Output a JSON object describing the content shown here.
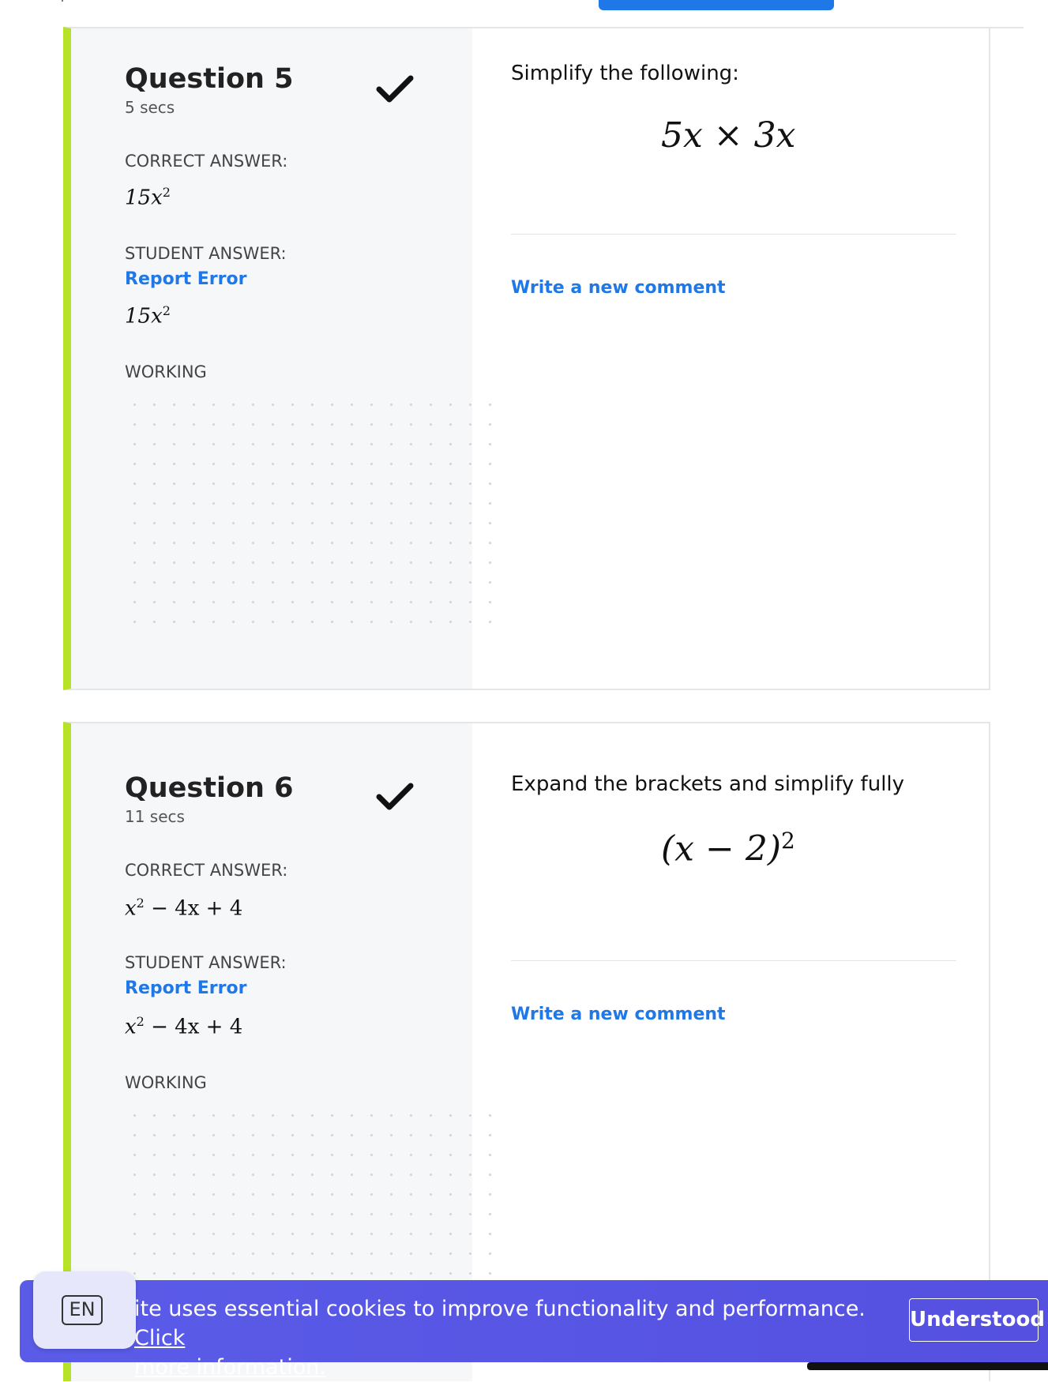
{
  "questions": [
    {
      "title": "Question 5",
      "time": "5 secs",
      "correct_label": "CORRECT ANSWER:",
      "correct_answer": {
        "base": "15x",
        "sup": "2"
      },
      "student_label": "STUDENT ANSWER:",
      "report_error": "Report Error",
      "student_answer": {
        "base": "15x",
        "sup": "2"
      },
      "working_label": "WORKING",
      "prompt": "Simplify the following:",
      "expression": {
        "text": "5x × 3x",
        "sup": ""
      },
      "comment_link": "Write a new comment",
      "status": "correct"
    },
    {
      "title": "Question 6",
      "time": "11 secs",
      "correct_label": "CORRECT ANSWER:",
      "correct_answer": {
        "pre": "x",
        "sup": "2",
        "post": " − 4x + 4"
      },
      "student_label": "STUDENT ANSWER:",
      "report_error": "Report Error",
      "student_answer": {
        "pre": "x",
        "sup": "2",
        "post": " − 4x + 4"
      },
      "working_label": "WORKING",
      "prompt": "Expand the brackets and simplify fully",
      "expression": {
        "text": "(x − 2)",
        "sup": "2"
      },
      "comment_link": "Write a new comment",
      "status": "correct"
    }
  ],
  "cookie_banner": {
    "text": "ite uses essential cookies to improve functionality and performance. ",
    "link_click": "Click",
    "link_more": "more information.",
    "button": "Understood"
  },
  "language": {
    "code": "EN"
  },
  "colors": {
    "accent_green": "#b8e227",
    "link_blue": "#1f78e8",
    "banner_purple": "#5a5ce8"
  }
}
